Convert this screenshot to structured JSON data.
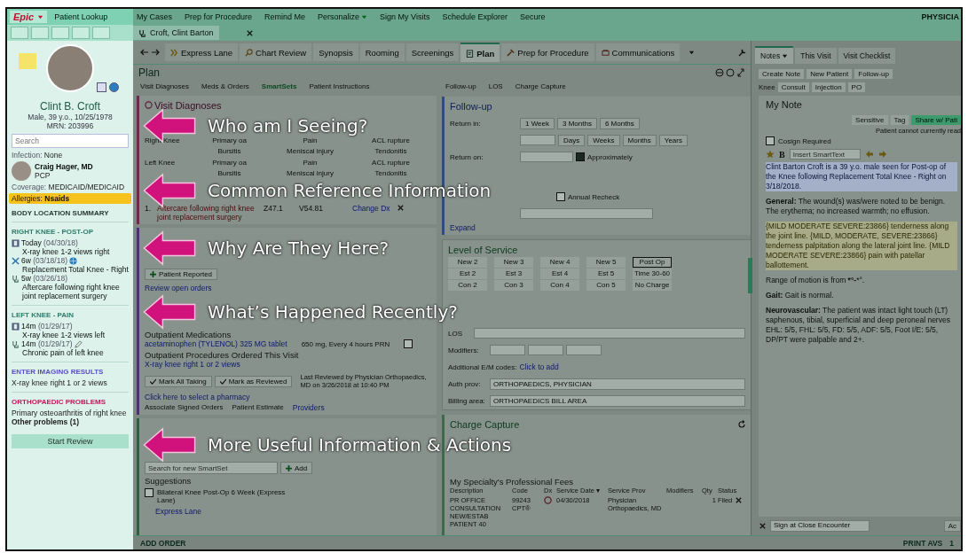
{
  "top_bar": {
    "epic_menu": "Epic",
    "items": [
      {
        "label": "Patient Lookup",
        "dropdown": false
      },
      {
        "label": "My Cases",
        "dropdown": false
      },
      {
        "label": "Prep for Procedure",
        "dropdown": false
      },
      {
        "label": "Remind Me",
        "dropdown": false
      },
      {
        "label": "Personalize",
        "dropdown": true
      },
      {
        "label": "Sign My Visits",
        "dropdown": false
      },
      {
        "label": "Schedule Explorer",
        "dropdown": false
      },
      {
        "label": "Secure",
        "dropdown": false
      }
    ],
    "user": "PHYSICIA"
  },
  "patient_tab": {
    "label": "Croft, Clint Barton"
  },
  "sidebar": {
    "patient_name": "Clint B. Croft",
    "demographics": "Male, 39 y.o., 10/25/1978",
    "mrn": "MRN: 203996",
    "search": {
      "placeholder": "Search"
    },
    "infection": {
      "label": "Infection:",
      "value": "None"
    },
    "pcp": {
      "name": "Craig Hager, MD",
      "role": "PCP"
    },
    "coverage": {
      "label": "Coverage:",
      "value": "MEDICAID/MEDICAID"
    },
    "allergies": {
      "label": "Allergies:",
      "value": "Nsaids"
    },
    "summary_title": "BODY LOCATION SUMMARY",
    "sections": [
      {
        "title": "RIGHT KNEE - POST-OP",
        "color": "#2e7d6b",
        "entries": [
          {
            "kind": "imaging",
            "when": "Today",
            "date": "(04/30/18)",
            "attachment": false,
            "detail": "X-ray knee 1-2 views right"
          },
          {
            "kind": "surgery",
            "when": "6w",
            "date": "(03/18/18)",
            "attachment": true,
            "detail": "Replacement Total Knee - Right"
          },
          {
            "kind": "visit",
            "when": "5w",
            "date": "(03/26/18)",
            "attachment": false,
            "detail": "Aftercare following right knee joint replacement surgery"
          }
        ]
      },
      {
        "title": "LEFT KNEE - PAIN",
        "color": "#2e7d6b",
        "entries": [
          {
            "kind": "imaging",
            "when": "14m",
            "date": "(01/29/17)",
            "attachment": false,
            "detail": "X-ray knee 1-2 views left"
          },
          {
            "kind": "visit",
            "when": "14m",
            "date": "(01/29/17)",
            "attachment": true,
            "detail": "Chronic pain of left knee"
          }
        ]
      },
      {
        "title": "ENTER IMAGING RESULTS",
        "color": "#5b4fc4",
        "lines": [
          {
            "text": "X-ray knee right 1 or 2 views",
            "bold": false
          }
        ]
      },
      {
        "title": "ORTHOPAEDIC PROBLEMS",
        "color": "#c2185b",
        "lines": [
          {
            "text": "Primary osteoarthritis of right knee",
            "bold": false
          },
          {
            "text": "Other problems (1)",
            "bold": true
          }
        ]
      }
    ],
    "start_button": "Start Review"
  },
  "activity_tabs": [
    {
      "label": "Express Lane",
      "selected": false
    },
    {
      "label": "Chart Review",
      "selected": false
    },
    {
      "label": "Synopsis",
      "selected": false
    },
    {
      "label": "Rooming",
      "selected": false
    },
    {
      "label": "Screenings",
      "selected": false
    },
    {
      "label": "Plan",
      "selected": true
    },
    {
      "label": "Prep for Procedure",
      "selected": false
    },
    {
      "label": "Communications",
      "selected": false
    }
  ],
  "plan_title": "Plan",
  "left_nav": [
    {
      "label": "Visit Diagnoses",
      "selected": false
    },
    {
      "label": "Meds & Orders",
      "selected": false
    },
    {
      "label": "SmartSets",
      "selected": true
    },
    {
      "label": "Patient Instructions",
      "selected": false
    }
  ],
  "right_nav": [
    {
      "label": "Follow-up",
      "selected": false
    },
    {
      "label": "LOS",
      "selected": false
    },
    {
      "label": "Charge Capture",
      "selected": false
    }
  ],
  "visit_diagnoses": {
    "title": "Visit Diagnoses",
    "body_areas": [
      {
        "label": "Right Knee",
        "options": [
          "Primary oa",
          "Pain",
          "ACL rupture",
          "Bursitis",
          "Meniscal injury",
          "Tendonitis"
        ]
      },
      {
        "label": "Left Knee",
        "options": [
          "Primary oa",
          "Pain",
          "ACL rupture",
          "Bursitis",
          "Meniscal injury",
          "Tendonitis"
        ]
      }
    ],
    "diagnoses": [
      {
        "number": "1.",
        "name": "Aftercare following right knee joint replacement surgery",
        "code_1": "Z47.1",
        "code_2": "V54.81",
        "action": "Change Dx"
      }
    ]
  },
  "meds_orders": {
    "patient_reported": "Patient Reported",
    "review_link": "Review open orders",
    "outpatient_meds_title": "Outpatient Medications",
    "medications": [
      {
        "name": "acetaminophen (TYLENOL) 325 MG tablet",
        "sig": "650 mg, Every 4 hours PRN",
        "checked": false
      }
    ],
    "procedures_title": "Outpatient Procedures Ordered This Visit",
    "procedures": [
      {
        "name": "X-ray knee right 1 or 2 views"
      }
    ],
    "buttons": [
      "Mark All Taking",
      "Mark as Reviewed"
    ],
    "last_reviewed": "Last Reviewed by Physician Orthopaedics, MD on 3/26/2018 at 10:40 PM",
    "pharmacy_link": "Click here to select a pharmacy",
    "actions": [
      "Associate Signed Orders",
      "Patient Estimate",
      "Providers"
    ]
  },
  "smartsets": {
    "search": {
      "placeholder": "Search for new SmartSet"
    },
    "add": "Add",
    "suggestions_title": "Suggestions",
    "suggestions": [
      {
        "label": "Bilateral Knee Post-Op 6 Week (Express Lane)",
        "checked": false
      }
    ],
    "link": "Express Lane"
  },
  "follow_up": {
    "title": "Follow-up",
    "return_in_label": "Return in:",
    "quick": [
      "1 Week",
      "3 Months",
      "6 Months"
    ],
    "units": [
      "Days",
      "Weeks",
      "Months",
      "Years"
    ],
    "return_on_label": "Return on:",
    "approximately": {
      "label": "Approximately",
      "checked": true
    },
    "annual_recheck": {
      "label": "Annual Recheck",
      "checked": false
    },
    "expand": "Expand"
  },
  "level_of_service": {
    "title": "Level of Service",
    "options": [
      {
        "label": "New 2",
        "selected": false
      },
      {
        "label": "New 3",
        "selected": false
      },
      {
        "label": "New 4",
        "selected": false
      },
      {
        "label": "New 5",
        "selected": false
      },
      {
        "label": "Post Op",
        "selected": true
      },
      {
        "label": "Est 2",
        "selected": false
      },
      {
        "label": "Est 3",
        "selected": false
      },
      {
        "label": "Est 4",
        "selected": false
      },
      {
        "label": "Est 5",
        "selected": false
      },
      {
        "label": "Time 30-60",
        "selected": false
      },
      {
        "label": "Con 2",
        "selected": false
      },
      {
        "label": "Con 3",
        "selected": false
      },
      {
        "label": "Con 4",
        "selected": false
      },
      {
        "label": "Con 5",
        "selected": false
      },
      {
        "label": "No Charge",
        "selected": false
      }
    ],
    "los_label": "LOS",
    "modifiers_label": "Modifiers:",
    "additional": {
      "label": "Additional E/M codes:",
      "link": "Click to add"
    },
    "auth_prov": {
      "label": "Auth prov:",
      "value": "ORTHOPAEDICS, PHYSICIAN"
    },
    "billing_area": {
      "label": "Billing area:",
      "value": "ORTHOPAEDICS BILL AREA"
    }
  },
  "charge_capture": {
    "title": "Charge Capture",
    "fees_title": "My Specialty's Professional Fees",
    "columns": [
      "Description",
      "Code",
      "Dx",
      "Service Date ▾",
      "Service Prov",
      "Modifiers",
      "Qty",
      "Status"
    ],
    "rows": [
      {
        "description": "PR OFFICE CONSULTATION NEW/ESTAB PATIENT 40",
        "code": "99243 CPT®",
        "service_date": "04/30/2018",
        "service_prov": "Physician Orthopaedics, MD",
        "qty": "1",
        "status": "Filed"
      }
    ]
  },
  "notes": {
    "tabs": [
      {
        "label": "Notes",
        "selected": true,
        "dropdown": true
      },
      {
        "label": "This Visit",
        "selected": false,
        "dropdown": false
      },
      {
        "label": "Visit Checklist",
        "selected": false,
        "dropdown": false
      }
    ],
    "templates_row_1": [
      "Create Note",
      "New Patient",
      "Follow-up"
    ],
    "templates_label": "Knee",
    "templates_row_2": [
      "Consult",
      "Injection",
      "PO"
    ],
    "note_title": "My Note",
    "note_buttons": [
      "Sensitive",
      "Tag"
    ],
    "share_button": "Share w/ Pati",
    "share_notice": "Patient cannot currently read",
    "cosign": {
      "label": "Cosign Required",
      "checked": false
    },
    "bold_tool": "B",
    "smarttext": {
      "placeholder": "Insert SmartText"
    },
    "paragraphs": [
      {
        "kind": "highlighted",
        "text": "Clint Barton Croft is a 39 y.o. male seen for Post-op of the Knee following Replacement Total Knee - Right on 3/18/2018."
      },
      {
        "kind": "plain",
        "text": "**General:** The wound(s) was/were noted to be benign. The erythema; no increased warmth; no effusion."
      },
      {
        "kind": "smartlist",
        "text": "{MILD MODERATE SEVERE:23866} tenderness along the joint line. {MILD, MODERATE, SEVERE:23866} tenderness palpitation along the lateral joint line. {MILD MODERATE SEVERE:23866} pain with patellar ballottement."
      },
      {
        "kind": "plain",
        "text": "Range of motion is from ***°-***°."
      },
      {
        "kind": "plain",
        "text": "**Gait:** Gait is normal."
      },
      {
        "kind": "plain",
        "text": "**Neurovascular:** The patient was intact light touch (LT) saphenous, tibial, superficial and deep peroneal nerves EHL: 5/5, FHL: 5/5, FD: 5/5, ADF: 5/5, Foot I/E: 5/5, DP/PT were palpable and 2+."
      }
    ],
    "sign_option": "Sign at Close Encounter",
    "accept_button": "Ac"
  },
  "bottom_bar": {
    "add_order": "ADD ORDER",
    "print_avs": "PRINT AVS",
    "count": "1"
  },
  "annotations": [
    "Who am I Seeing?",
    "Common Reference Information",
    "Why Are They Here?",
    "What’s Happened Recently?",
    "More Useful Information & Actions"
  ]
}
